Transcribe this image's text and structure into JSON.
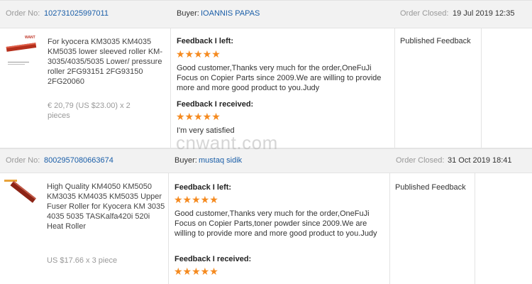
{
  "watermark": "cnwant.com",
  "orders": [
    {
      "order_label": "Order No:",
      "order_no": "102731025997011",
      "buyer_label": "Buyer:",
      "buyer_name": "IOANNIS PAPAS",
      "closed_label": "Order Closed:",
      "closed_date": "19 Jul 2019 12:35",
      "product_image_label": "WANT",
      "product_name": "For kyocera KM3035 KM4035 KM5035 lower sleeved roller KM-3035/4035/5035 Lower/ pressure roller 2FG93151 2FG93150 2FG20060",
      "price": "€ 20,79 (US $23.00) x 2 pieces",
      "fb_left_title": "Feedback I left:",
      "fb_left_stars": "★★★★★",
      "fb_left_text": "Good customer,Thanks very much for the order,OneFuJi Focus on Copier Parts since 2009.We are willing to provide more and more good product to you.Judy",
      "fb_recv_title": "Feedback I received:",
      "fb_recv_stars": "★★★★★",
      "fb_recv_text": "I'm very satisfied",
      "status": "Published Feedback"
    },
    {
      "order_label": "Order No:",
      "order_no": "8002957080663674",
      "buyer_label": "Buyer:",
      "buyer_name": "mustaq sidik",
      "closed_label": "Order Closed:",
      "closed_date": "31 Oct 2019 18:41",
      "product_name": "High Quality KM4050 KM5050 KM3035 KM4035 KM5035 Upper Fuser Roller for Kyocera KM 3035 4035 5035 TASKalfa420i 520i Heat Roller",
      "price": "US $17.66 x 3 piece",
      "fb_left_title": "Feedback I left:",
      "fb_left_stars": "★★★★★",
      "fb_left_text": "Good customer,Thanks very much for the order,OneFuJi Focus on Copier Parts,toner powder since 2009.We are willing to provide more and more good product to you.Judy",
      "fb_recv_title": "Feedback I received:",
      "fb_recv_stars": "★★★★★",
      "status": "Published Feedback"
    }
  ]
}
